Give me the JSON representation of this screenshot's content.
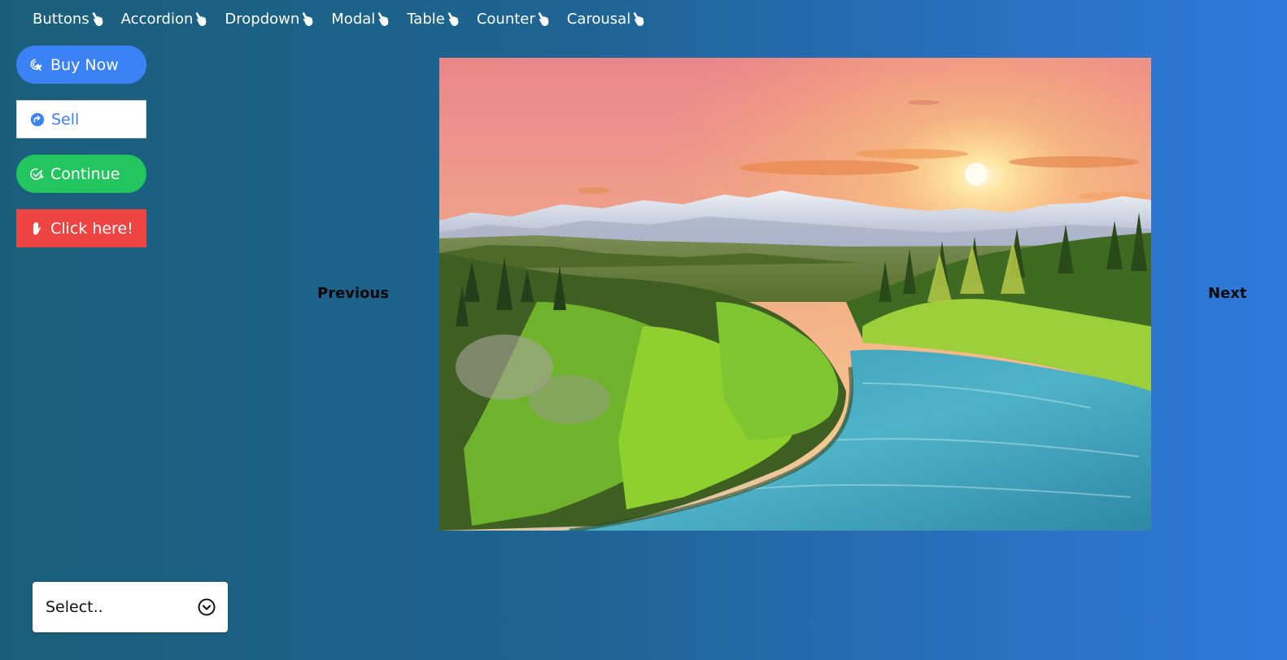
{
  "nav": {
    "items": [
      {
        "label": "Buttons",
        "icon": "pointing-hand-icon"
      },
      {
        "label": "Accordion",
        "icon": "pointing-hand-icon"
      },
      {
        "label": "Dropdown",
        "icon": "pointing-hand-icon"
      },
      {
        "label": "Modal",
        "icon": "pointing-hand-icon"
      },
      {
        "label": "Table",
        "icon": "pointing-hand-icon"
      },
      {
        "label": "Counter",
        "icon": "pointing-hand-icon"
      },
      {
        "label": "Carousal",
        "icon": "pointing-hand-icon"
      }
    ]
  },
  "buttons": {
    "buy_now": {
      "label": "Buy Now",
      "icon": "cursor-click-icon",
      "color": "#3b82f6"
    },
    "sell": {
      "label": "Sell",
      "icon": "arrow-circle-icon",
      "color": "#3b82f6"
    },
    "continue": {
      "label": "Continue",
      "icon": "check-badge-icon",
      "color": "#22c55e"
    },
    "click_here": {
      "label": "Click here!",
      "icon": "hand-icon",
      "color": "#ef4444"
    }
  },
  "carousel": {
    "previous_label": "Previous",
    "next_label": "Next"
  },
  "dropdown": {
    "selected": "Select..",
    "icon": "chevron-down-circle-icon"
  }
}
